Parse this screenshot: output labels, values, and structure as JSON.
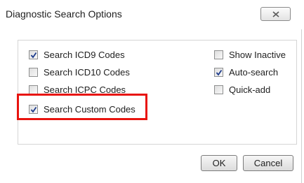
{
  "dialog": {
    "title": "Diagnostic Search Options",
    "close_icon": "close-x-icon"
  },
  "options_left": [
    {
      "label": "Search ICD9 Codes",
      "checked": true
    },
    {
      "label": "Search ICD10 Codes",
      "checked": false
    },
    {
      "label": "Search ICPC Codes",
      "checked": false
    },
    {
      "label": "Search Custom Codes",
      "checked": true
    }
  ],
  "options_right": [
    {
      "label": "Show Inactive",
      "checked": false
    },
    {
      "label": "Auto-search",
      "checked": true
    },
    {
      "label": "Quick-add",
      "checked": false
    }
  ],
  "buttons": {
    "ok": "OK",
    "cancel": "Cancel"
  },
  "colors": {
    "highlight": "#e8140f",
    "check": "#1e3c8c"
  }
}
